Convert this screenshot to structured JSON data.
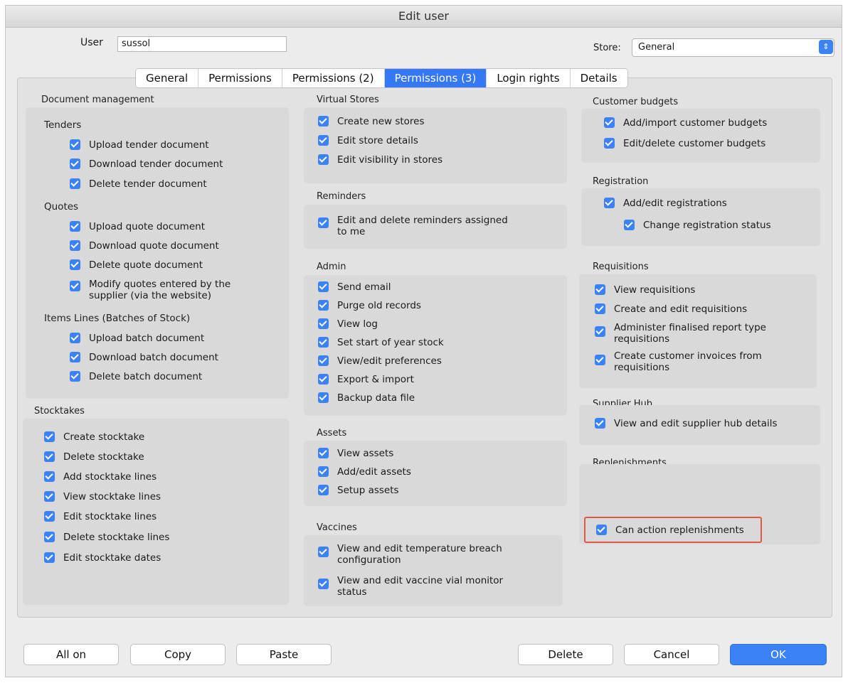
{
  "window": {
    "title": "Edit user"
  },
  "user": {
    "label": "User",
    "value": "sussol"
  },
  "store": {
    "label": "Store:",
    "value": "General"
  },
  "tabs": [
    {
      "label": "General"
    },
    {
      "label": "Permissions"
    },
    {
      "label": "Permissions (2)"
    },
    {
      "label": "Permissions (3)"
    },
    {
      "label": "Login rights"
    },
    {
      "label": "Details"
    }
  ],
  "col1": {
    "doc_mgmt_title": "Document management",
    "tenders_title": "Tenders",
    "tenders": [
      "Upload tender document",
      "Download tender document",
      "Delete tender document"
    ],
    "quotes_title": "Quotes",
    "quotes": [
      "Upload quote document",
      "Download quote document",
      "Delete quote document",
      "Modify quotes entered by the",
      "supplier (via the website)"
    ],
    "items_title": "Items Lines (Batches of Stock)",
    "items": [
      "Upload batch document",
      "Download batch document",
      "Delete batch document"
    ],
    "stocktakes_title": "Stocktakes",
    "stocktakes": [
      "Create stocktake",
      "Delete stocktake",
      "Add stocktake lines",
      "View stocktake lines",
      "Edit stocktake lines",
      "Delete stocktake lines",
      "Edit stocktake dates"
    ]
  },
  "col2": {
    "virtual_title": "Virtual Stores",
    "virtual": [
      "Create new stores",
      "Edit store details",
      "Edit visibility in stores"
    ],
    "reminders_title": "Reminders",
    "reminders": [
      "Edit and delete reminders assigned",
      "to me"
    ],
    "admin_title": "Admin",
    "admin": [
      "Send email",
      "Purge old records",
      "View log",
      "Set start of year stock",
      "View/edit preferences",
      "Export & import",
      "Backup data file"
    ],
    "assets_title": "Assets",
    "assets": [
      "View assets",
      "Add/edit assets",
      "Setup assets"
    ],
    "vaccines_title": "Vaccines",
    "vaccines": [
      "View and edit temperature breach",
      "configuration",
      "View and edit vaccine vial monitor",
      "status"
    ]
  },
  "col3": {
    "budgets_title": "Customer budgets",
    "budgets": [
      "Add/import customer budgets",
      "Edit/delete customer budgets"
    ],
    "registration_title": "Registration",
    "registration": [
      "Add/edit registrations",
      "Change registration status"
    ],
    "requisitions_title": "Requisitions",
    "requisitions": [
      "View requisitions",
      "Create and edit requisitions",
      "Administer finalised report type",
      "requisitions",
      "Create customer invoices from",
      "requisitions"
    ],
    "supplier_title": "Supplier Hub",
    "supplier": [
      "View and edit supplier hub details"
    ],
    "replenish_title": "Replenishments",
    "replenish": [
      "Can action replenishments"
    ]
  },
  "buttons": {
    "all_on": "All on",
    "copy": "Copy",
    "paste": "Paste",
    "delete": "Delete",
    "cancel": "Cancel",
    "ok": "OK"
  },
  "colors": {
    "accent": "#3b82f6",
    "highlight": "#e05a45"
  }
}
